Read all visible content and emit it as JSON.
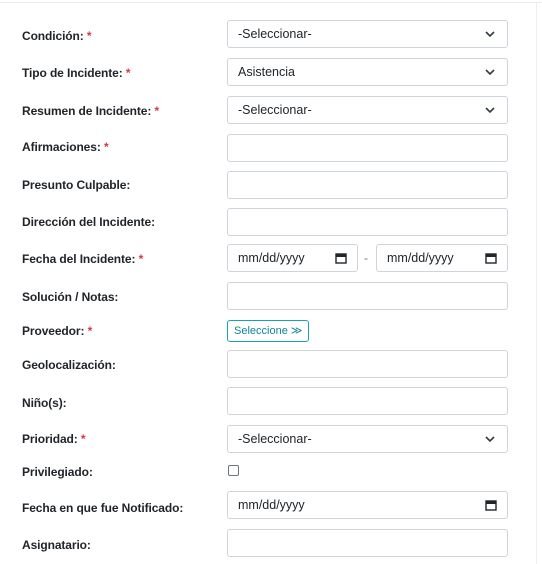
{
  "form": {
    "condicion": {
      "label": "Condición:",
      "required": "*",
      "value": "-Seleccionar-"
    },
    "tipo": {
      "label": "Tipo de Incidente:",
      "required": "*",
      "value": "Asistencia"
    },
    "resumen": {
      "label": "Resumen de Incidente:",
      "required": "*",
      "value": "-Seleccionar-"
    },
    "afirmaciones": {
      "label": "Afirmaciones:",
      "required": "*",
      "value": ""
    },
    "presunto": {
      "label": "Presunto Culpable:",
      "value": ""
    },
    "direccion": {
      "label": "Dirección del Incidente:",
      "value": ""
    },
    "fecha": {
      "label": "Fecha del Incidente:",
      "required": "*",
      "from": "mm/dd/yyyy",
      "separator": "-",
      "to": "mm/dd/yyyy"
    },
    "solucion": {
      "label": "Solución / Notas:",
      "value": ""
    },
    "proveedor": {
      "label": "Proveedor:",
      "required": "*",
      "button": "Seleccione ≫"
    },
    "geo": {
      "label": "Geolocalización:",
      "value": ""
    },
    "ninos": {
      "label": "Niño(s):",
      "value": ""
    },
    "prioridad": {
      "label": "Prioridad:",
      "required": "*",
      "value": "-Seleccionar-"
    },
    "privilegiado": {
      "label": "Privilegiado:",
      "checked": false
    },
    "notificado": {
      "label": "Fecha en que fue Notificado:",
      "value": "mm/dd/yyyy"
    },
    "asignatario": {
      "label": "Asignatario:",
      "value": ""
    }
  },
  "icons": {
    "select": "chevron-down-icon",
    "date": "calendar-icon"
  },
  "colors": {
    "required": "#dc3545",
    "button_border": "#17a2b8",
    "button_text": "#138496",
    "field_border": "#ced4da"
  }
}
